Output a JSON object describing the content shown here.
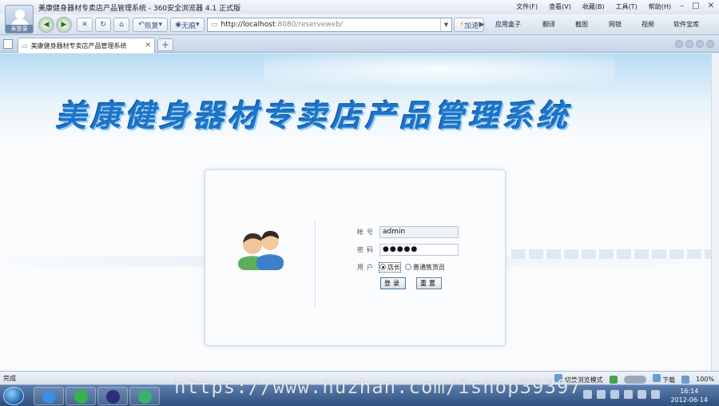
{
  "window": {
    "title": "美康健身器材专卖店产品管理系统 - 360安全浏览器 4.1 正式版",
    "avatar_label": "未登录",
    "menus": [
      "文件(F)",
      "查看(V)",
      "收藏(B)",
      "工具(T)",
      "帮助(H)"
    ]
  },
  "toolbar": {
    "back_label": "恢复",
    "no_trace_label": "无痕",
    "address_host": "http://localhost",
    "address_rest": ":8080/reserveweb/",
    "speed_label": "加速",
    "extras": [
      "应用盒子",
      "翻译",
      "截图",
      "网银",
      "视频",
      "软件宝库"
    ]
  },
  "tabs": [
    {
      "label": "美康健身器材专卖店产品管理系统"
    }
  ],
  "page": {
    "site_title": "美康健身器材专卖店产品管理系统",
    "login": {
      "account_label": "帐号",
      "account_value": "admin",
      "password_label": "密码",
      "password_value": "●●●●●",
      "user_label": "用户",
      "role_options": [
        "店长",
        "普通售货员"
      ],
      "selected_role": "店长",
      "login_button": "登录",
      "reset_button": "重置"
    }
  },
  "statusbar": {
    "left": "完成",
    "mode": "切换浏览模式",
    "download": "下载",
    "zoom": "100%"
  },
  "taskbar": {
    "time": "16:14",
    "date": "2012-06-14"
  },
  "watermark": "https://www.huzhan.com/ishop39397",
  "colors": {
    "title_blue": "#1c74c8",
    "banner_sky": "#b7dbf2",
    "taskbar": "#2f4f7e"
  }
}
